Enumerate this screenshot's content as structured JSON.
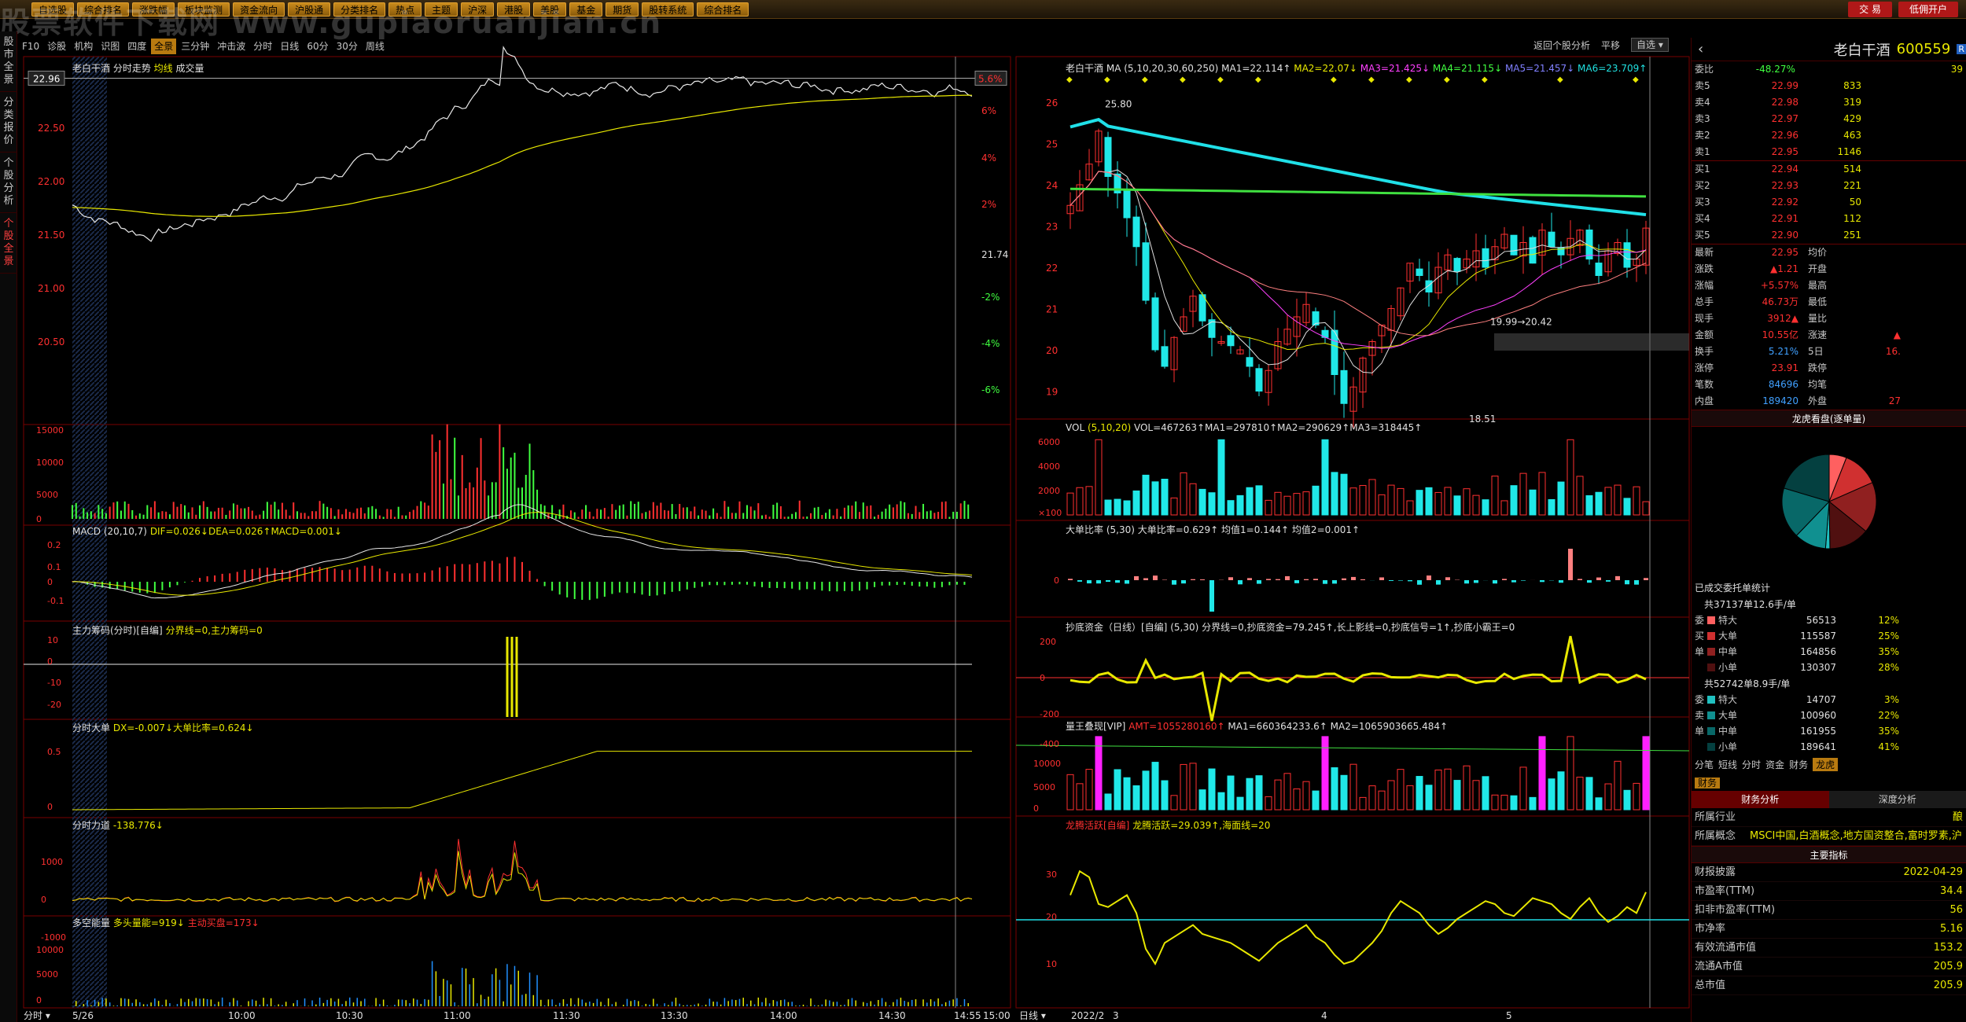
{
  "watermark": "股票软件下载网 www.gupiaoruanjian.cn",
  "topbar": {
    "items": [
      "自选股",
      "综合排名",
      "涨跌幅",
      "板块监测",
      "资金流向",
      "沪股通",
      "分类排名",
      "热点",
      "主题",
      "沪深",
      "港股",
      "美股",
      "基金",
      "期货",
      "股转系统",
      "综合排名"
    ],
    "trade_label": "交 易",
    "open_label": "低佣开户"
  },
  "sidetabs": [
    "股市全景",
    "分类报价",
    "个股分析",
    "个股全景"
  ],
  "toolbar": {
    "items": [
      "F10",
      "诊股",
      "机构",
      "识图",
      "四度",
      "全景",
      "三分钟",
      "冲击波",
      "分时",
      "日线",
      "60分",
      "30分",
      "周线"
    ],
    "active": "全景"
  },
  "rhead": {
    "back": "返回个股分析",
    "flat": "平移",
    "select": "自选"
  },
  "left": {
    "title": "老白干酒  分时走势",
    "avg_label": "均线",
    "vol_label": "成交量",
    "price_ticks": [
      "22.50",
      "22.00",
      "21.50",
      "21.00",
      "20.50"
    ],
    "pct_ticks": [
      "6%",
      "4%",
      "2%",
      "-2%",
      "-4%",
      "-6%"
    ],
    "last_price": "22.96",
    "last_pct": "5.6%",
    "pre_close": "21.74",
    "vol_ticks": [
      "15000",
      "10000",
      "5000",
      "0"
    ],
    "macd_title": "MACD",
    "macd_params": "(20,10,7)",
    "macd_vals": "DIF=0.026↓DEA=0.026↑MACD=0.001↓",
    "macd_ticks": [
      "0.2",
      "0.1",
      "0",
      "-0.1"
    ],
    "zl_title": "主力筹码(分时)[自编]",
    "zl_vals": "分界线=0,主力筹码=0",
    "zl_ticks": [
      "10",
      "0",
      "-10",
      "-20"
    ],
    "fdd_title": "分时大单",
    "fdd_vals": "DX=-0.007↓大单比率=0.624↓",
    "fdd_ticks": [
      "0.5",
      "0"
    ],
    "flow_title": "分时力道",
    "flow_vals": "-138.776↓",
    "flow_ticks": [
      "1000",
      "0",
      "-1000"
    ],
    "dk_title": "多空能量",
    "dk_vals": "多头量能=919↓",
    "dk_vals2": "主动买盘=173↓",
    "dk_ticks": [
      "10000",
      "5000",
      "0"
    ],
    "time_ticks": [
      "5/26",
      "10:00",
      "10:30",
      "11:00",
      "11:30",
      "13:30",
      "14:00",
      "14:30",
      "14:55",
      "15:00"
    ],
    "bottom_label": "分时"
  },
  "right": {
    "title": "老白干酒",
    "ma_label": "MA",
    "ma_params": "(5,10,20,30,60,250)",
    "ma_vals": [
      "MA1=22.114↑",
      "MA2=22.07↓",
      "MA3=21.425↓",
      "MA4=21.115↓",
      "MA5=21.457↓",
      "MA6=23.709↑"
    ],
    "price_ticks": [
      "26",
      "25",
      "24",
      "23",
      "22",
      "21",
      "20",
      "19"
    ],
    "hi_label": "25.80",
    "lo_label": "18.51",
    "mid_label": "19.99→20.42",
    "vol_title": "VOL",
    "vol_params": "(5,10,20)",
    "vol_vals": "VOL=467263↑MA1=297810↑MA2=290629↑MA3=318445↑",
    "vol_ticks": [
      "6000",
      "4000",
      "2000",
      "×100"
    ],
    "dd_title": "大单比率",
    "dd_vals": "(5,30) 大单比率=0.629↑ 均值1=0.144↑ 均值2=0.001↑",
    "cd_title": "抄底资金（日线）[自编]",
    "cd_vals": "(5,30) 分界线=0,抄底资金=79.245↑,长上影线=0,抄底信号=1↑,抄底小霸王=0",
    "cd_ticks": [
      "200",
      "0",
      "-200",
      "-400"
    ],
    "lw_title": "量王叠现[VIP]",
    "lw_vals": "AMT=1055280160↑",
    "lw_vals2": "MA1=660364233.6↑ MA2=1065903665.484↑",
    "lw_ticks": [
      "10000",
      "5000",
      "0"
    ],
    "lt_title": "龙腾活跃[自编]",
    "lt_vals": "龙腾活跃=29.039↑,海面线=20",
    "lt_ticks": [
      "30",
      "20",
      "10"
    ],
    "date_ticks": [
      "2022/2",
      "3",
      "4",
      "5"
    ],
    "bottom_label": "日线"
  },
  "quote": {
    "name": "老白干酒",
    "code": "600559",
    "wb_label": "委比",
    "wb_val": "-48.27%",
    "wb_num": "39",
    "asks": [
      [
        "卖5",
        "22.99",
        "833"
      ],
      [
        "卖4",
        "22.98",
        "319"
      ],
      [
        "卖3",
        "22.97",
        "429"
      ],
      [
        "卖2",
        "22.96",
        "463"
      ],
      [
        "卖1",
        "22.95",
        "1146"
      ]
    ],
    "bids": [
      [
        "买1",
        "22.94",
        "514"
      ],
      [
        "买2",
        "22.93",
        "221"
      ],
      [
        "买3",
        "22.92",
        "50"
      ],
      [
        "买4",
        "22.91",
        "112"
      ],
      [
        "买5",
        "22.90",
        "251"
      ]
    ],
    "stats": [
      [
        "最新",
        "22.95",
        "均价",
        ""
      ],
      [
        "涨跌",
        "▲1.21",
        "开盘",
        ""
      ],
      [
        "涨幅",
        "+5.57%",
        "最高",
        ""
      ],
      [
        "总手",
        "46.73万",
        "最低",
        ""
      ],
      [
        "现手",
        "3912▲",
        "量比",
        ""
      ],
      [
        "金额",
        "10.55亿",
        "涨速",
        "▲"
      ],
      [
        "换手",
        "5.21%",
        "5日",
        "16."
      ],
      [
        "涨停",
        "23.91",
        "跌停",
        ""
      ],
      [
        "笔数",
        "84696",
        "均笔",
        ""
      ],
      [
        "内盘",
        "189420",
        "外盘",
        "27"
      ]
    ],
    "pie_title": "龙虎看盘(逐单量)",
    "deal_title": "已成交委托单统计",
    "buy_total": "共37137单12.6手/单",
    "buy_rows": [
      [
        "委",
        "特大",
        "56513",
        "12%"
      ],
      [
        "买",
        "大单",
        "115587",
        "25%"
      ],
      [
        "单",
        "中单",
        "164856",
        "35%"
      ],
      [
        "",
        "小单",
        "130307",
        "28%"
      ]
    ],
    "sell_total": "共52742单8.9手/单",
    "sell_rows": [
      [
        "委",
        "特大",
        "14707",
        "3%"
      ],
      [
        "卖",
        "大单",
        "100960",
        "22%"
      ],
      [
        "单",
        "中单",
        "161955",
        "35%"
      ],
      [
        "",
        "小单",
        "189641",
        "41%"
      ]
    ],
    "tabs": [
      "分笔",
      "短线",
      "分时",
      "资金",
      "财务",
      "龙虎"
    ],
    "tab_active": "龙虎",
    "fin_tab": "财务",
    "fin_left": "财务分析",
    "fin_right": "深度分析",
    "industry_label": "所属行业",
    "industry_val": "酿",
    "concept_label": "所属概念",
    "concept_val": "MSCI中国,白酒概念,地方国资整合,富时罗素,沪",
    "main_index": "主要指标",
    "fin_rows": [
      [
        "财报披露",
        "2022-04-29"
      ],
      [
        "市盈率(TTM)",
        "34.4"
      ],
      [
        "扣非市盈率(TTM)",
        "56"
      ],
      [
        "市净率",
        "5.16"
      ],
      [
        "有效流通市值",
        "153.2"
      ],
      [
        "流通A市值",
        "205.9"
      ],
      [
        "总市值",
        "205.9"
      ]
    ]
  },
  "colors": {
    "up": "#ff3030",
    "down": "#20e8e8",
    "yellow": "#e8e800",
    "grid": "#5a0000",
    "bg": "#000"
  }
}
